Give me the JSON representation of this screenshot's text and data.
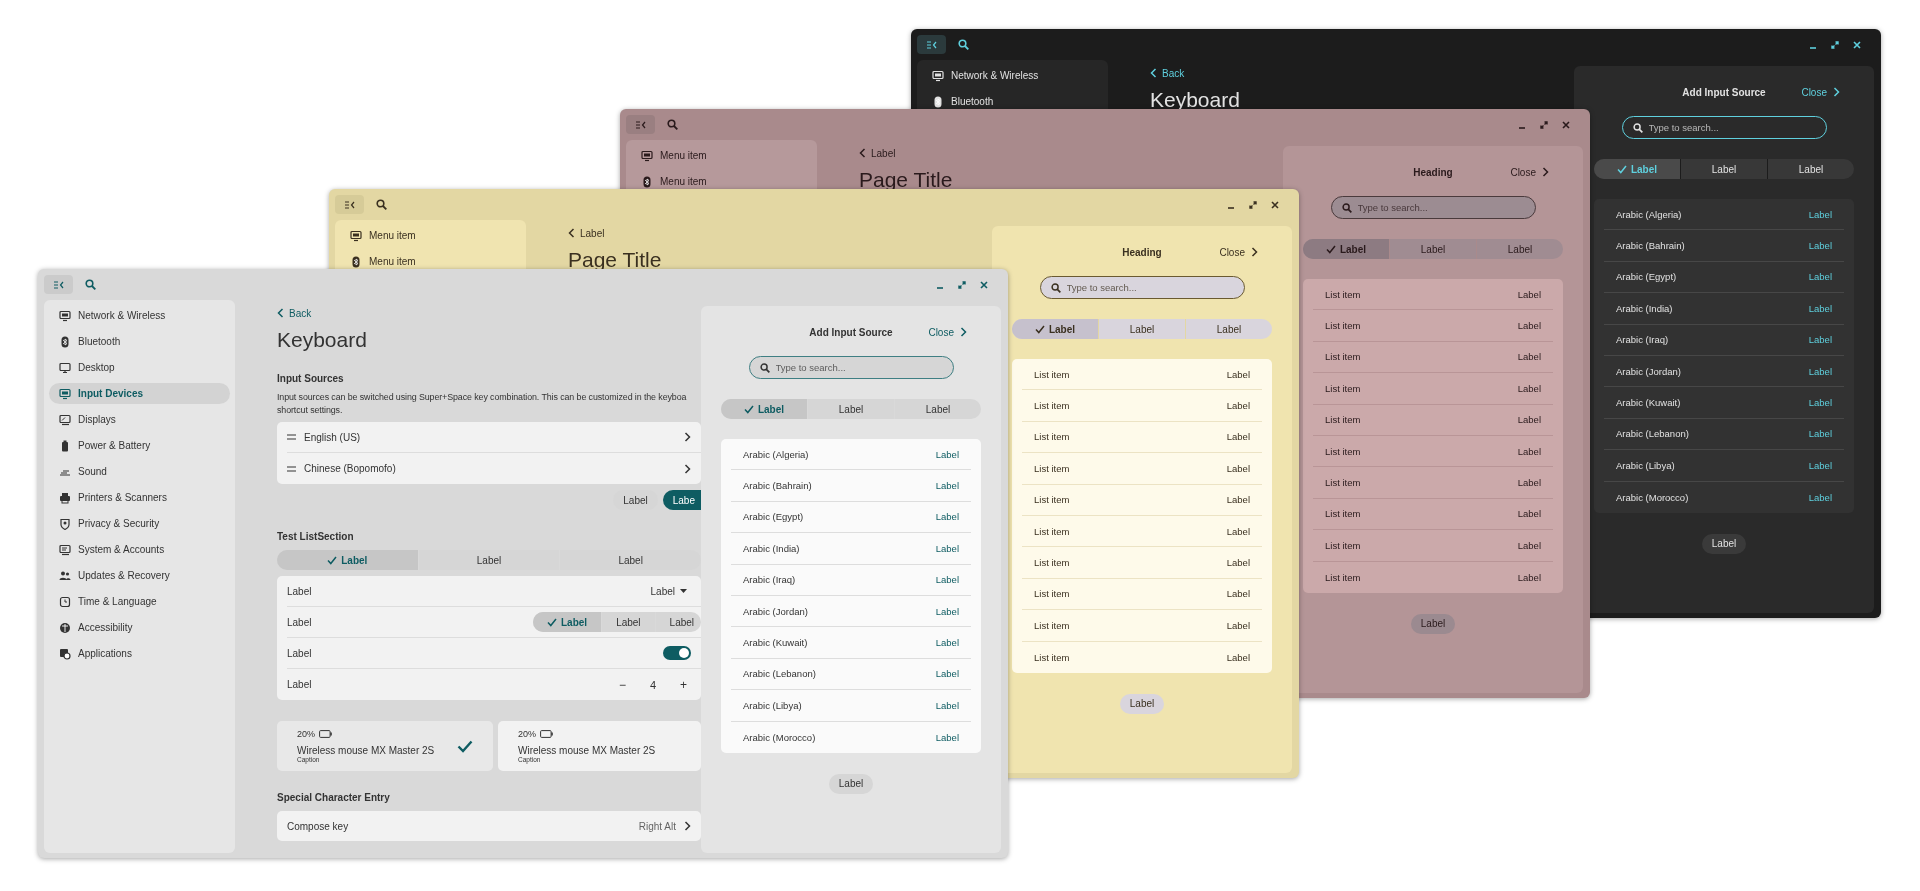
{
  "windows": [
    {
      "sidebar": {
        "items": [
          {
            "label": "Network & Wireless",
            "selected": false
          },
          {
            "label": "Bluetooth",
            "selected": false
          }
        ]
      },
      "back": "Back",
      "title": "Keyboard",
      "panel": {
        "heading": "Add Input Source",
        "close": "Close",
        "search": {
          "placeholder": "Type to search..."
        },
        "segments": [
          {
            "label": "Label",
            "selected": true
          },
          {
            "label": "Label",
            "selected": false
          },
          {
            "label": "Label",
            "selected": false
          }
        ],
        "rows": [
          {
            "name": "Arabic (Algeria)",
            "value": "Label"
          },
          {
            "name": "Arabic (Bahrain)",
            "value": "Label"
          },
          {
            "name": "Arabic (Egypt)",
            "value": "Label"
          },
          {
            "name": "Arabic (India)",
            "value": "Label"
          },
          {
            "name": "Arabic (Iraq)",
            "value": "Label"
          },
          {
            "name": "Arabic (Jordan)",
            "value": "Label"
          },
          {
            "name": "Arabic (Kuwait)",
            "value": "Label"
          },
          {
            "name": "Arabic (Lebanon)",
            "value": "Label"
          },
          {
            "name": "Arabic (Libya)",
            "value": "Label"
          },
          {
            "name": "Arabic (Morocco)",
            "value": "Label"
          }
        ],
        "button": "Label"
      }
    },
    {
      "sidebar": {
        "items": [
          {
            "label": "Menu item",
            "selected": false
          },
          {
            "label": "Menu item",
            "selected": false
          }
        ]
      },
      "back": "Label",
      "title": "Page Title",
      "panel": {
        "heading": "Heading",
        "close": "Close",
        "search": {
          "placeholder": "Type to search..."
        },
        "segments": [
          {
            "label": "Label",
            "selected": true
          },
          {
            "label": "Label",
            "selected": false
          },
          {
            "label": "Label",
            "selected": false
          }
        ],
        "rows": [
          {
            "name": "List item",
            "value": "Label"
          },
          {
            "name": "List item",
            "value": "Label"
          },
          {
            "name": "List item",
            "value": "Label"
          },
          {
            "name": "List item",
            "value": "Label"
          },
          {
            "name": "List item",
            "value": "Label"
          },
          {
            "name": "List item",
            "value": "Label"
          },
          {
            "name": "List item",
            "value": "Label"
          },
          {
            "name": "List item",
            "value": "Label"
          },
          {
            "name": "List item",
            "value": "Label"
          },
          {
            "name": "List item",
            "value": "Label"
          }
        ],
        "button": "Label"
      }
    },
    {
      "sidebar": {
        "items": [
          {
            "label": "Menu item",
            "selected": false
          },
          {
            "label": "Menu item",
            "selected": false
          }
        ]
      },
      "back": "Label",
      "title": "Page Title",
      "panel": {
        "heading": "Heading",
        "close": "Close",
        "search": {
          "placeholder": "Type to search..."
        },
        "segments": [
          {
            "label": "Label",
            "selected": true
          },
          {
            "label": "Label",
            "selected": false
          },
          {
            "label": "Label",
            "selected": false
          }
        ],
        "rows": [
          {
            "name": "List item",
            "value": "Label"
          },
          {
            "name": "List item",
            "value": "Label"
          },
          {
            "name": "List item",
            "value": "Label"
          },
          {
            "name": "List item",
            "value": "Label"
          },
          {
            "name": "List item",
            "value": "Label"
          },
          {
            "name": "List item",
            "value": "Label"
          },
          {
            "name": "List item",
            "value": "Label"
          },
          {
            "name": "List item",
            "value": "Label"
          },
          {
            "name": "List item",
            "value": "Label"
          },
          {
            "name": "List item",
            "value": "Label"
          }
        ],
        "button": "Label"
      }
    },
    {
      "sidebar": {
        "items": [
          {
            "label": "Network & Wireless",
            "selected": false
          },
          {
            "label": "Bluetooth",
            "selected": false
          },
          {
            "label": "Desktop",
            "selected": false
          },
          {
            "label": "Input Devices",
            "selected": true
          },
          {
            "label": "Displays",
            "selected": false
          },
          {
            "label": "Power & Battery",
            "selected": false
          },
          {
            "label": "Sound",
            "selected": false
          },
          {
            "label": "Printers & Scanners",
            "selected": false
          },
          {
            "label": "Privacy & Security",
            "selected": false
          },
          {
            "label": "System & Accounts",
            "selected": false
          },
          {
            "label": "Updates & Recovery",
            "selected": false
          },
          {
            "label": "Time & Language",
            "selected": false
          },
          {
            "label": "Accessibility",
            "selected": false
          },
          {
            "label": "Applications",
            "selected": false
          }
        ]
      },
      "back": "Back",
      "title": "Keyboard",
      "content": {
        "input_sources": {
          "heading": "Input Sources",
          "description_lines": [
            "Input sources can be switched using Super+Space key combination. This can be customized in the keyboa",
            "shortcut settings."
          ],
          "rows": [
            {
              "label": "English (US)"
            },
            {
              "label": "Chinese (Bopomofo)"
            }
          ],
          "buttons": [
            {
              "label": "Label",
              "kind": "secondary"
            },
            {
              "label": "Labe",
              "kind": "primary"
            }
          ]
        },
        "test_list_section": {
          "heading": "Test ListSection",
          "segments": [
            {
              "label": "Label",
              "selected": true
            },
            {
              "label": "Label",
              "selected": false
            },
            {
              "label": "Label",
              "selected": false
            }
          ],
          "rows": [
            {
              "kind": "dropdown",
              "label": "Label",
              "value": "Label"
            },
            {
              "kind": "segmented",
              "label": "Label",
              "segments": [
                {
                  "label": "Label",
                  "selected": true
                },
                {
                  "label": "Label",
                  "selected": false
                },
                {
                  "label": "Label",
                  "selected": false
                }
              ]
            },
            {
              "kind": "toggle",
              "label": "Label",
              "on": true
            },
            {
              "kind": "stepper",
              "label": "Label",
              "value": "4",
              "decrement": "−",
              "increment": "+"
            }
          ]
        },
        "devices": [
          {
            "battery": "20%",
            "name": "Wireless mouse MX Master 2S",
            "caption": "Caption",
            "selected": true
          },
          {
            "battery": "20%",
            "name": "Wireless mouse MX Master 2S",
            "caption": "Caption",
            "selected": false
          }
        ],
        "special_character_entry": {
          "heading": "Special Character Entry",
          "rows": [
            {
              "label": "Compose key",
              "value": "Right Alt"
            }
          ]
        }
      },
      "panel": {
        "heading": "Add Input Source",
        "close": "Close",
        "search": {
          "placeholder": "Type to search..."
        },
        "segments": [
          {
            "label": "Label",
            "selected": true
          },
          {
            "label": "Label",
            "selected": false
          },
          {
            "label": "Label",
            "selected": false
          }
        ],
        "rows": [
          {
            "name": "Arabic (Algeria)",
            "value": "Label"
          },
          {
            "name": "Arabic (Bahrain)",
            "value": "Label"
          },
          {
            "name": "Arabic (Egypt)",
            "value": "Label"
          },
          {
            "name": "Arabic (India)",
            "value": "Label"
          },
          {
            "name": "Arabic (Iraq)",
            "value": "Label"
          },
          {
            "name": "Arabic (Jordan)",
            "value": "Label"
          },
          {
            "name": "Arabic (Kuwait)",
            "value": "Label"
          },
          {
            "name": "Arabic (Lebanon)",
            "value": "Label"
          },
          {
            "name": "Arabic (Libya)",
            "value": "Label"
          },
          {
            "name": "Arabic (Morocco)",
            "value": "Label"
          }
        ],
        "button": "Label"
      }
    }
  ]
}
